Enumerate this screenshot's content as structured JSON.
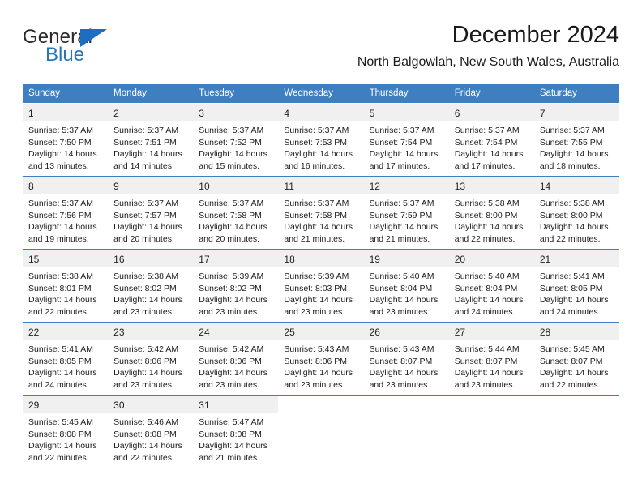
{
  "brand": {
    "name_part1": "General",
    "name_part2": "Blue",
    "flag_icon": "triangle-flag-icon",
    "accent_color": "#1b6ec2"
  },
  "header": {
    "month_title": "December 2024",
    "location": "North Balgowlah, New South Wales, Australia"
  },
  "calendar": {
    "header_bg": "#3d7fc1",
    "daynum_band_bg": "#f0f0f0",
    "weekdays": [
      "Sunday",
      "Monday",
      "Tuesday",
      "Wednesday",
      "Thursday",
      "Friday",
      "Saturday"
    ],
    "weeks": [
      {
        "days": [
          {
            "num": "1",
            "sunrise": "Sunrise: 5:37 AM",
            "sunset": "Sunset: 7:50 PM",
            "daylight1": "Daylight: 14 hours",
            "daylight2": "and 13 minutes."
          },
          {
            "num": "2",
            "sunrise": "Sunrise: 5:37 AM",
            "sunset": "Sunset: 7:51 PM",
            "daylight1": "Daylight: 14 hours",
            "daylight2": "and 14 minutes."
          },
          {
            "num": "3",
            "sunrise": "Sunrise: 5:37 AM",
            "sunset": "Sunset: 7:52 PM",
            "daylight1": "Daylight: 14 hours",
            "daylight2": "and 15 minutes."
          },
          {
            "num": "4",
            "sunrise": "Sunrise: 5:37 AM",
            "sunset": "Sunset: 7:53 PM",
            "daylight1": "Daylight: 14 hours",
            "daylight2": "and 16 minutes."
          },
          {
            "num": "5",
            "sunrise": "Sunrise: 5:37 AM",
            "sunset": "Sunset: 7:54 PM",
            "daylight1": "Daylight: 14 hours",
            "daylight2": "and 17 minutes."
          },
          {
            "num": "6",
            "sunrise": "Sunrise: 5:37 AM",
            "sunset": "Sunset: 7:54 PM",
            "daylight1": "Daylight: 14 hours",
            "daylight2": "and 17 minutes."
          },
          {
            "num": "7",
            "sunrise": "Sunrise: 5:37 AM",
            "sunset": "Sunset: 7:55 PM",
            "daylight1": "Daylight: 14 hours",
            "daylight2": "and 18 minutes."
          }
        ]
      },
      {
        "days": [
          {
            "num": "8",
            "sunrise": "Sunrise: 5:37 AM",
            "sunset": "Sunset: 7:56 PM",
            "daylight1": "Daylight: 14 hours",
            "daylight2": "and 19 minutes."
          },
          {
            "num": "9",
            "sunrise": "Sunrise: 5:37 AM",
            "sunset": "Sunset: 7:57 PM",
            "daylight1": "Daylight: 14 hours",
            "daylight2": "and 20 minutes."
          },
          {
            "num": "10",
            "sunrise": "Sunrise: 5:37 AM",
            "sunset": "Sunset: 7:58 PM",
            "daylight1": "Daylight: 14 hours",
            "daylight2": "and 20 minutes."
          },
          {
            "num": "11",
            "sunrise": "Sunrise: 5:37 AM",
            "sunset": "Sunset: 7:58 PM",
            "daylight1": "Daylight: 14 hours",
            "daylight2": "and 21 minutes."
          },
          {
            "num": "12",
            "sunrise": "Sunrise: 5:37 AM",
            "sunset": "Sunset: 7:59 PM",
            "daylight1": "Daylight: 14 hours",
            "daylight2": "and 21 minutes."
          },
          {
            "num": "13",
            "sunrise": "Sunrise: 5:38 AM",
            "sunset": "Sunset: 8:00 PM",
            "daylight1": "Daylight: 14 hours",
            "daylight2": "and 22 minutes."
          },
          {
            "num": "14",
            "sunrise": "Sunrise: 5:38 AM",
            "sunset": "Sunset: 8:00 PM",
            "daylight1": "Daylight: 14 hours",
            "daylight2": "and 22 minutes."
          }
        ]
      },
      {
        "days": [
          {
            "num": "15",
            "sunrise": "Sunrise: 5:38 AM",
            "sunset": "Sunset: 8:01 PM",
            "daylight1": "Daylight: 14 hours",
            "daylight2": "and 22 minutes."
          },
          {
            "num": "16",
            "sunrise": "Sunrise: 5:38 AM",
            "sunset": "Sunset: 8:02 PM",
            "daylight1": "Daylight: 14 hours",
            "daylight2": "and 23 minutes."
          },
          {
            "num": "17",
            "sunrise": "Sunrise: 5:39 AM",
            "sunset": "Sunset: 8:02 PM",
            "daylight1": "Daylight: 14 hours",
            "daylight2": "and 23 minutes."
          },
          {
            "num": "18",
            "sunrise": "Sunrise: 5:39 AM",
            "sunset": "Sunset: 8:03 PM",
            "daylight1": "Daylight: 14 hours",
            "daylight2": "and 23 minutes."
          },
          {
            "num": "19",
            "sunrise": "Sunrise: 5:40 AM",
            "sunset": "Sunset: 8:04 PM",
            "daylight1": "Daylight: 14 hours",
            "daylight2": "and 23 minutes."
          },
          {
            "num": "20",
            "sunrise": "Sunrise: 5:40 AM",
            "sunset": "Sunset: 8:04 PM",
            "daylight1": "Daylight: 14 hours",
            "daylight2": "and 24 minutes."
          },
          {
            "num": "21",
            "sunrise": "Sunrise: 5:41 AM",
            "sunset": "Sunset: 8:05 PM",
            "daylight1": "Daylight: 14 hours",
            "daylight2": "and 24 minutes."
          }
        ]
      },
      {
        "days": [
          {
            "num": "22",
            "sunrise": "Sunrise: 5:41 AM",
            "sunset": "Sunset: 8:05 PM",
            "daylight1": "Daylight: 14 hours",
            "daylight2": "and 24 minutes."
          },
          {
            "num": "23",
            "sunrise": "Sunrise: 5:42 AM",
            "sunset": "Sunset: 8:06 PM",
            "daylight1": "Daylight: 14 hours",
            "daylight2": "and 23 minutes."
          },
          {
            "num": "24",
            "sunrise": "Sunrise: 5:42 AM",
            "sunset": "Sunset: 8:06 PM",
            "daylight1": "Daylight: 14 hours",
            "daylight2": "and 23 minutes."
          },
          {
            "num": "25",
            "sunrise": "Sunrise: 5:43 AM",
            "sunset": "Sunset: 8:06 PM",
            "daylight1": "Daylight: 14 hours",
            "daylight2": "and 23 minutes."
          },
          {
            "num": "26",
            "sunrise": "Sunrise: 5:43 AM",
            "sunset": "Sunset: 8:07 PM",
            "daylight1": "Daylight: 14 hours",
            "daylight2": "and 23 minutes."
          },
          {
            "num": "27",
            "sunrise": "Sunrise: 5:44 AM",
            "sunset": "Sunset: 8:07 PM",
            "daylight1": "Daylight: 14 hours",
            "daylight2": "and 23 minutes."
          },
          {
            "num": "28",
            "sunrise": "Sunrise: 5:45 AM",
            "sunset": "Sunset: 8:07 PM",
            "daylight1": "Daylight: 14 hours",
            "daylight2": "and 22 minutes."
          }
        ]
      },
      {
        "days": [
          {
            "num": "29",
            "sunrise": "Sunrise: 5:45 AM",
            "sunset": "Sunset: 8:08 PM",
            "daylight1": "Daylight: 14 hours",
            "daylight2": "and 22 minutes."
          },
          {
            "num": "30",
            "sunrise": "Sunrise: 5:46 AM",
            "sunset": "Sunset: 8:08 PM",
            "daylight1": "Daylight: 14 hours",
            "daylight2": "and 22 minutes."
          },
          {
            "num": "31",
            "sunrise": "Sunrise: 5:47 AM",
            "sunset": "Sunset: 8:08 PM",
            "daylight1": "Daylight: 14 hours",
            "daylight2": "and 21 minutes."
          },
          {
            "num": "",
            "sunrise": "",
            "sunset": "",
            "daylight1": "",
            "daylight2": ""
          },
          {
            "num": "",
            "sunrise": "",
            "sunset": "",
            "daylight1": "",
            "daylight2": ""
          },
          {
            "num": "",
            "sunrise": "",
            "sunset": "",
            "daylight1": "",
            "daylight2": ""
          },
          {
            "num": "",
            "sunrise": "",
            "sunset": "",
            "daylight1": "",
            "daylight2": ""
          }
        ]
      }
    ]
  }
}
